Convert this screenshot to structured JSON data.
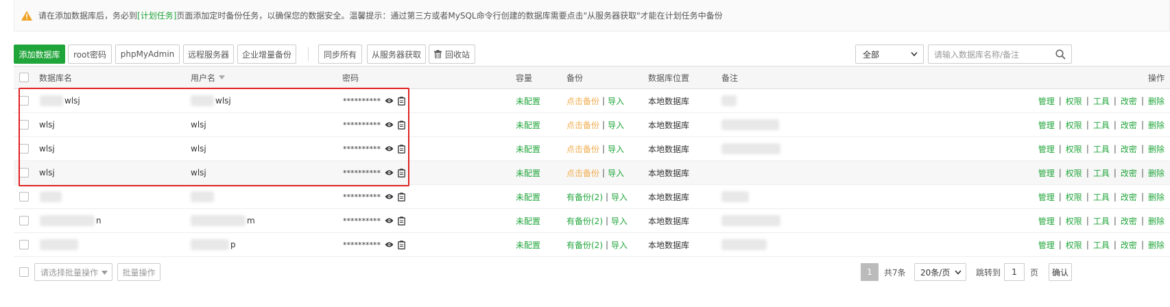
{
  "alert": {
    "before": "请在添加数据库后，务必到",
    "link": "[计划任务]",
    "after": "页面添加定时备份任务，以确保您的数据安全。温馨提示：通过第三方或者MySQL命令行创建的数据库需要点击\"从服务器获取\"才能在计划任务中备份"
  },
  "toolbar": {
    "add_db": "添加数据库",
    "root_pwd": "root密码",
    "phpmyadmin": "phpMyAdmin",
    "remote_server": "远程服务器",
    "enterprise_backup": "企业增量备份",
    "sync_all": "同步所有",
    "fetch_from_server": "从服务器获取",
    "recycle_bin": "回收站",
    "filter_selected": "全部",
    "search_placeholder": "请输入数据库名称/备注"
  },
  "table": {
    "headers": {
      "name": "数据库名",
      "user": "用户名",
      "password": "密码",
      "capacity": "容量",
      "backup": "备份",
      "location": "数据库位置",
      "remark": "备注",
      "actions": "操作"
    },
    "rows": [
      {
        "name": "wlsj",
        "user": "wlsj",
        "password": "**********",
        "capacity": "未配置",
        "backup": "点击备份",
        "backup_state": "none",
        "import": "导入",
        "location": "本地数据库"
      },
      {
        "name": "wlsj",
        "user": "wlsj",
        "password": "**********",
        "capacity": "未配置",
        "backup": "点击备份",
        "backup_state": "none",
        "import": "导入",
        "location": "本地数据库"
      },
      {
        "name": "wlsj",
        "user": "wlsj",
        "password": "**********",
        "capacity": "未配置",
        "backup": "点击备份",
        "backup_state": "none",
        "import": "导入",
        "location": "本地数据库"
      },
      {
        "name": "wlsj",
        "user": "wlsj",
        "password": "**********",
        "capacity": "未配置",
        "backup": "点击备份",
        "backup_state": "none",
        "import": "导入",
        "location": "本地数据库"
      },
      {
        "name": "",
        "user": "",
        "password": "**********",
        "capacity": "未配置",
        "backup": "有备份(2)",
        "backup_state": "has",
        "import": "导入",
        "location": "本地数据库"
      },
      {
        "name": "n",
        "user": "m",
        "password": "**********",
        "capacity": "未配置",
        "backup": "有备份(2)",
        "backup_state": "has",
        "import": "导入",
        "location": "本地数据库"
      },
      {
        "name": "",
        "user": "p",
        "password": "**********",
        "capacity": "未配置",
        "backup": "有备份(2)",
        "backup_state": "has",
        "import": "导入",
        "location": "本地数据库"
      }
    ],
    "actions": {
      "manage": "管理",
      "perm": "权限",
      "tools": "工具",
      "change_pwd": "改密",
      "delete": "删除"
    }
  },
  "footer": {
    "batch_placeholder": "请选择批量操作",
    "batch_btn": "批量操作",
    "current_page": "1",
    "total": "共7条",
    "per_page": "20条/页",
    "goto_label": "跳转到",
    "goto_value": "1",
    "page_unit": "页",
    "confirm": "确认"
  },
  "colors": {
    "accent": "#20a53a",
    "warning": "#f0ad4e",
    "highlight_box": "#e02020"
  }
}
